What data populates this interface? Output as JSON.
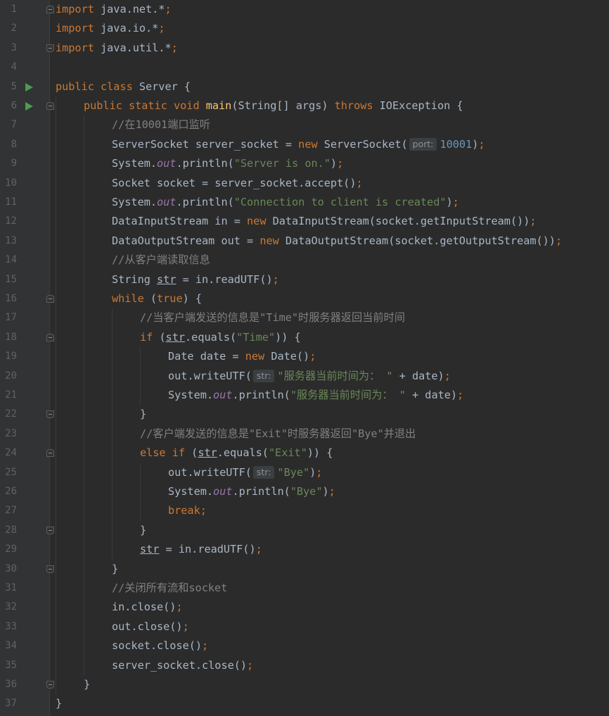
{
  "editor": {
    "language": "java",
    "colors": {
      "background": "#2b2b2b",
      "gutter": "#313335",
      "keyword": "#cc7832",
      "string": "#6a8759",
      "number": "#6897bb",
      "comment": "#808080",
      "method_declaration": "#ffc66d",
      "static_field": "#9876aa",
      "plain": "#a9b7c6",
      "run_icon": "#499c54"
    },
    "lines": [
      {
        "n": "1",
        "indent": 0,
        "fold": "start",
        "tokens": [
          [
            "kw",
            "import"
          ],
          [
            "p",
            " java.net.*"
          ],
          [
            "kw",
            ";"
          ]
        ]
      },
      {
        "n": "2",
        "indent": 0,
        "tokens": [
          [
            "kw",
            "import"
          ],
          [
            "p",
            " java.io.*"
          ],
          [
            "kw",
            ";"
          ]
        ]
      },
      {
        "n": "3",
        "indent": 0,
        "fold": "end",
        "tokens": [
          [
            "kw",
            "import"
          ],
          [
            "p",
            " java.util.*"
          ],
          [
            "kw",
            ";"
          ]
        ]
      },
      {
        "n": "4",
        "indent": 0,
        "tokens": []
      },
      {
        "n": "5",
        "indent": 0,
        "run": true,
        "tokens": [
          [
            "kw",
            "public class"
          ],
          [
            "p",
            " Server {"
          ]
        ]
      },
      {
        "n": "6",
        "indent": 1,
        "run": true,
        "fold": "start",
        "tokens": [
          [
            "kw",
            "public static void"
          ],
          [
            "p",
            " "
          ],
          [
            "fn",
            "main"
          ],
          [
            "p",
            "(String[] args) "
          ],
          [
            "kw",
            "throws"
          ],
          [
            "p",
            " IOException {"
          ]
        ]
      },
      {
        "n": "7",
        "indent": 2,
        "tokens": [
          [
            "cmt",
            "//在10001端口监听"
          ]
        ]
      },
      {
        "n": "8",
        "indent": 2,
        "tokens": [
          [
            "p",
            "ServerSocket server_socket = "
          ],
          [
            "kw",
            "new"
          ],
          [
            "p",
            " ServerSocket("
          ],
          [
            "hint",
            "port:"
          ],
          [
            "num",
            "10001"
          ],
          [
            "p",
            ")"
          ],
          [
            "kw",
            ";"
          ]
        ]
      },
      {
        "n": "9",
        "indent": 2,
        "tokens": [
          [
            "p",
            "System."
          ],
          [
            "fld",
            "out"
          ],
          [
            "p",
            ".println("
          ],
          [
            "str",
            "\"Server is on.\""
          ],
          [
            "p",
            ")"
          ],
          [
            "kw",
            ";"
          ]
        ]
      },
      {
        "n": "10",
        "indent": 2,
        "tokens": [
          [
            "p",
            "Socket socket = server_socket.accept()"
          ],
          [
            "kw",
            ";"
          ]
        ]
      },
      {
        "n": "11",
        "indent": 2,
        "tokens": [
          [
            "p",
            "System."
          ],
          [
            "fld",
            "out"
          ],
          [
            "p",
            ".println("
          ],
          [
            "str",
            "\"Connection to client is created\""
          ],
          [
            "p",
            ")"
          ],
          [
            "kw",
            ";"
          ]
        ]
      },
      {
        "n": "12",
        "indent": 2,
        "tokens": [
          [
            "p",
            "DataInputStream in = "
          ],
          [
            "kw",
            "new"
          ],
          [
            "p",
            " DataInputStream(socket.getInputStream())"
          ],
          [
            "kw",
            ";"
          ]
        ]
      },
      {
        "n": "13",
        "indent": 2,
        "tokens": [
          [
            "p",
            "DataOutputStream out = "
          ],
          [
            "kw",
            "new"
          ],
          [
            "p",
            " DataOutputStream(socket.getOutputStream())"
          ],
          [
            "kw",
            ";"
          ]
        ]
      },
      {
        "n": "14",
        "indent": 2,
        "tokens": [
          [
            "cmt",
            "//从客户端读取信息"
          ]
        ]
      },
      {
        "n": "15",
        "indent": 2,
        "tokens": [
          [
            "p",
            "String "
          ],
          [
            "var",
            "str"
          ],
          [
            "p",
            " = in.readUTF()"
          ],
          [
            "kw",
            ";"
          ]
        ]
      },
      {
        "n": "16",
        "indent": 2,
        "fold": "start",
        "tokens": [
          [
            "kw",
            "while"
          ],
          [
            "p",
            " ("
          ],
          [
            "kw",
            "true"
          ],
          [
            "p",
            ") {"
          ]
        ]
      },
      {
        "n": "17",
        "indent": 3,
        "tokens": [
          [
            "cmt",
            "//当客户端发送的信息是\"Time\"时服务器返回当前时间"
          ]
        ]
      },
      {
        "n": "18",
        "indent": 3,
        "fold": "start",
        "tokens": [
          [
            "kw",
            "if"
          ],
          [
            "p",
            " ("
          ],
          [
            "var",
            "str"
          ],
          [
            "p",
            ".equals("
          ],
          [
            "str",
            "\"Time\""
          ],
          [
            "p",
            ")) {"
          ]
        ]
      },
      {
        "n": "19",
        "indent": 4,
        "tokens": [
          [
            "p",
            "Date date = "
          ],
          [
            "kw",
            "new"
          ],
          [
            "p",
            " Date()"
          ],
          [
            "kw",
            ";"
          ]
        ]
      },
      {
        "n": "20",
        "indent": 4,
        "tokens": [
          [
            "p",
            "out.writeUTF("
          ],
          [
            "hint",
            "str:"
          ],
          [
            "str",
            "\"服务器当前时间为： \""
          ],
          [
            "p",
            " + date)"
          ],
          [
            "kw",
            ";"
          ]
        ]
      },
      {
        "n": "21",
        "indent": 4,
        "tokens": [
          [
            "p",
            "System."
          ],
          [
            "fld",
            "out"
          ],
          [
            "p",
            ".println("
          ],
          [
            "str",
            "\"服务器当前时间为： \""
          ],
          [
            "p",
            " + date)"
          ],
          [
            "kw",
            ";"
          ]
        ]
      },
      {
        "n": "22",
        "indent": 3,
        "fold": "end",
        "tokens": [
          [
            "p",
            "}"
          ]
        ]
      },
      {
        "n": "23",
        "indent": 3,
        "tokens": [
          [
            "cmt",
            "//客户端发送的信息是\"Exit\"时服务器返回\"Bye\"并退出"
          ]
        ]
      },
      {
        "n": "24",
        "indent": 3,
        "fold": "start",
        "tokens": [
          [
            "kw",
            "else if"
          ],
          [
            "p",
            " ("
          ],
          [
            "var",
            "str"
          ],
          [
            "p",
            ".equals("
          ],
          [
            "str",
            "\"Exit\""
          ],
          [
            "p",
            ")) {"
          ]
        ]
      },
      {
        "n": "25",
        "indent": 4,
        "tokens": [
          [
            "p",
            "out.writeUTF("
          ],
          [
            "hint",
            "str:"
          ],
          [
            "str",
            "\"Bye\""
          ],
          [
            "p",
            ")"
          ],
          [
            "kw",
            ";"
          ]
        ]
      },
      {
        "n": "26",
        "indent": 4,
        "tokens": [
          [
            "p",
            "System."
          ],
          [
            "fld",
            "out"
          ],
          [
            "p",
            ".println("
          ],
          [
            "str",
            "\"Bye\""
          ],
          [
            "p",
            ")"
          ],
          [
            "kw",
            ";"
          ]
        ]
      },
      {
        "n": "27",
        "indent": 4,
        "tokens": [
          [
            "kw",
            "break;"
          ]
        ]
      },
      {
        "n": "28",
        "indent": 3,
        "fold": "end",
        "tokens": [
          [
            "p",
            "}"
          ]
        ]
      },
      {
        "n": "29",
        "indent": 3,
        "tokens": [
          [
            "var",
            "str"
          ],
          [
            "p",
            " = in.readUTF()"
          ],
          [
            "kw",
            ";"
          ]
        ]
      },
      {
        "n": "30",
        "indent": 2,
        "fold": "end",
        "tokens": [
          [
            "p",
            "}"
          ]
        ]
      },
      {
        "n": "31",
        "indent": 2,
        "tokens": [
          [
            "cmt",
            "//关闭所有流和socket"
          ]
        ]
      },
      {
        "n": "32",
        "indent": 2,
        "tokens": [
          [
            "p",
            "in.close()"
          ],
          [
            "kw",
            ";"
          ]
        ]
      },
      {
        "n": "33",
        "indent": 2,
        "tokens": [
          [
            "p",
            "out.close()"
          ],
          [
            "kw",
            ";"
          ]
        ]
      },
      {
        "n": "34",
        "indent": 2,
        "tokens": [
          [
            "p",
            "socket.close()"
          ],
          [
            "kw",
            ";"
          ]
        ]
      },
      {
        "n": "35",
        "indent": 2,
        "tokens": [
          [
            "p",
            "server_socket.close()"
          ],
          [
            "kw",
            ";"
          ]
        ]
      },
      {
        "n": "36",
        "indent": 1,
        "fold": "end",
        "tokens": [
          [
            "p",
            "}"
          ]
        ]
      },
      {
        "n": "37",
        "indent": 0,
        "tokens": [
          [
            "p",
            "}"
          ]
        ]
      }
    ]
  }
}
